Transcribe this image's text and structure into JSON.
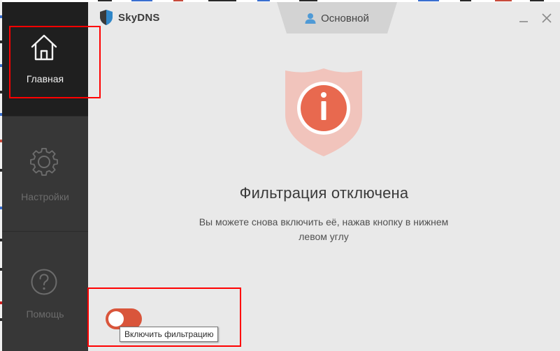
{
  "app": {
    "logo_text": "SkyDNS",
    "colors": {
      "sidebar_bg": "#373737",
      "sidebar_active_bg": "#1f1f1f",
      "content_bg": "#e9e9e9",
      "accent_red": "#d9553b",
      "shield_fill": "#f1c4bc",
      "badge_fill": "#e8694f",
      "logo_blue": "#2f86c8",
      "annotation_red": "#ff0000"
    }
  },
  "sidebar": {
    "items": [
      {
        "label": "Главная",
        "icon": "home-icon",
        "active": true
      },
      {
        "label": "Настройки",
        "icon": "gear-icon",
        "active": false
      },
      {
        "label": "Помощь",
        "icon": "help-icon",
        "active": false
      }
    ]
  },
  "header": {
    "profile_label": "Основной",
    "profile_icon": "user-icon",
    "minimize_icon": "minimize-icon",
    "close_icon": "close-icon"
  },
  "main": {
    "status_icon": "info-shield-icon",
    "status_title": "Фильтрация отключена",
    "status_description": "Вы можете снова включить её, нажав кнопку в нижнем левом углу",
    "toggle": {
      "state": "off",
      "tooltip": "Включить фильтрацию"
    }
  }
}
